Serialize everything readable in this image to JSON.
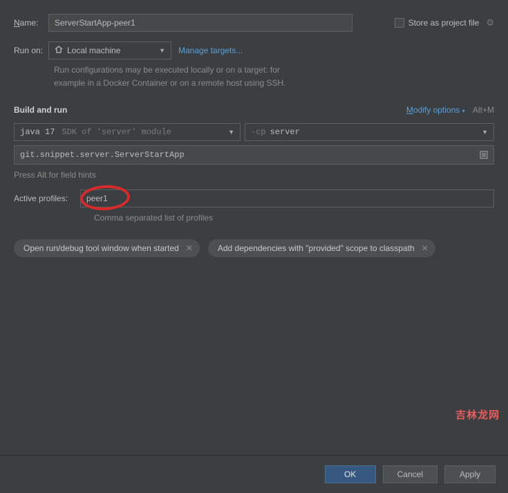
{
  "name": {
    "label_prefix": "N",
    "label_rest": "ame:",
    "value": "ServerStartApp-peer1"
  },
  "store": {
    "prefix": "S",
    "rest": "tore as project file"
  },
  "run_on": {
    "label": "Run on:",
    "selected": "Local machine",
    "manage_link": "Manage targets...",
    "help_line1": "Run configurations may be executed locally or on a target: for",
    "help_line2": "example in a Docker Container or on a remote host using SSH."
  },
  "build": {
    "title": "Build and run",
    "modify_prefix": "M",
    "modify_rest": "odify options",
    "shortcut": "Alt+M",
    "jdk": "java 17",
    "jdk_hint": "SDK of 'server' module",
    "cp_prefix": "-cp",
    "cp_value": "server",
    "main_class": "git.snippet.server.ServerStartApp",
    "field_hint": "Press Alt for field hints"
  },
  "profiles": {
    "label": "Active profiles:",
    "value": "peer1",
    "hint": "Comma separated list of profiles"
  },
  "chips": {
    "open_tool": "Open run/debug tool window when started",
    "provided": "Add dependencies with \"provided\" scope to classpath"
  },
  "footer": {
    "ok": "OK",
    "cancel": "Cancel",
    "apply": "Apply"
  },
  "watermark": "吉林龙网"
}
